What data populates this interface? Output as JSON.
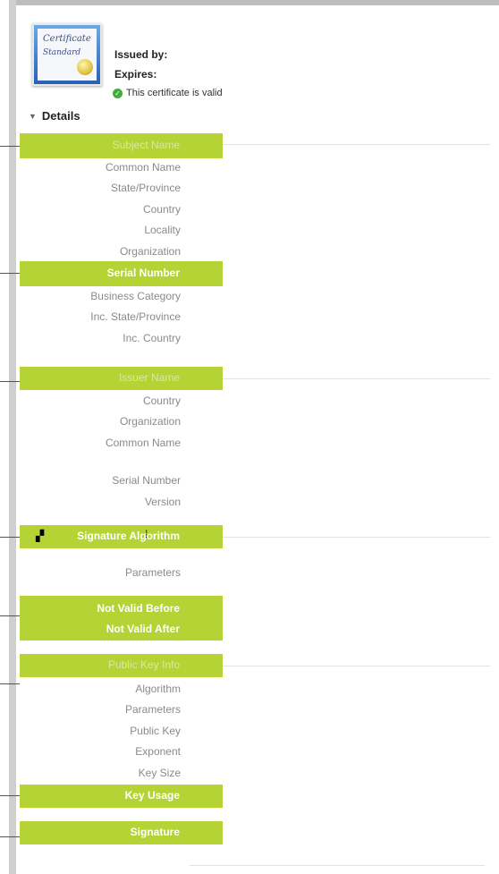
{
  "header": {
    "cert_image_line1": "Certificate",
    "cert_image_line2": "Standard",
    "issued_by_label": "Issued by:",
    "expires_label": "Expires:",
    "valid_text": "This certificate is valid"
  },
  "details": {
    "toggle_label": "Details",
    "subject": {
      "title": "Subject Name",
      "rows": [
        "Common Name",
        "State/Province",
        "Country",
        "Locality",
        "Organization"
      ]
    },
    "subject_highlight": "Serial Number",
    "business": {
      "rows": [
        "Business Category",
        "Inc. State/Province",
        "Inc. Country"
      ]
    },
    "issuer": {
      "title": "Issuer Name",
      "rows": [
        "Country",
        "Organization",
        "Common Name"
      ]
    },
    "serial_version": {
      "rows": [
        "Serial Number",
        "Version"
      ]
    },
    "signature_algorithm": {
      "title": "Signature Algorithm",
      "rows": [
        "Parameters"
      ]
    },
    "validity": {
      "not_before": "Not Valid Before",
      "not_after": "Not Valid After"
    },
    "public_key": {
      "title": "Public Key Info",
      "rows": [
        "Algorithm",
        "Parameters",
        "Public Key",
        "Exponent",
        "Key Size"
      ]
    },
    "key_usage": "Key Usage",
    "signature": "Signature"
  },
  "colors": {
    "highlight": "#b5d334",
    "label_gray": "#8a8a8a",
    "valid_green": "#3fae3a"
  }
}
